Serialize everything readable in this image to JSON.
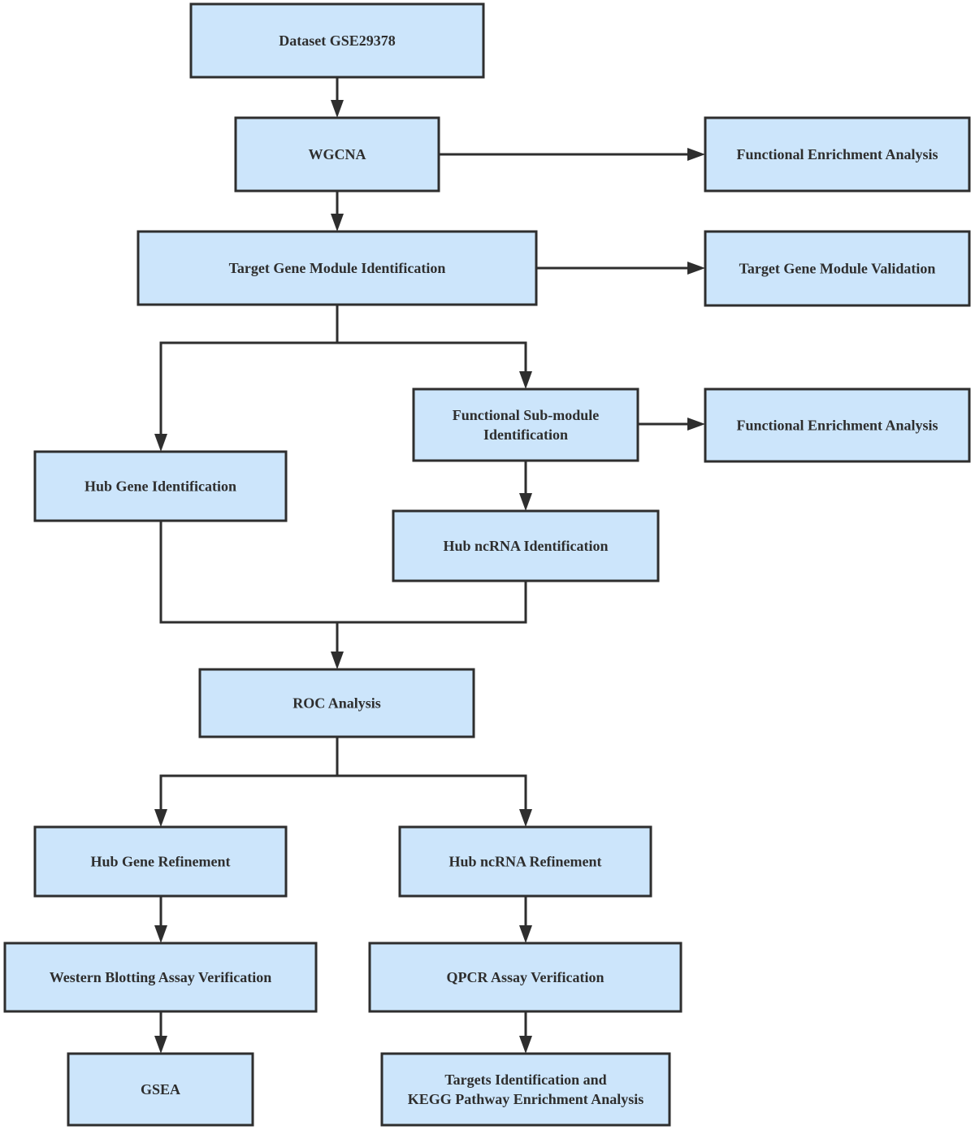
{
  "diagram": {
    "type": "flowchart",
    "colors": {
      "box_fill": "#cce5fb",
      "box_border": "#2e2e2e",
      "text": "#2e2e2e",
      "edge": "#2e2e2e"
    },
    "nodes": [
      {
        "id": "dataset",
        "lines": [
          "Dataset GSE29378"
        ]
      },
      {
        "id": "wgcna",
        "lines": [
          "WGCNA"
        ]
      },
      {
        "id": "fea1",
        "lines": [
          "Functional Enrichment Analysis"
        ]
      },
      {
        "id": "tgmi",
        "lines": [
          "Target Gene Module Identification"
        ]
      },
      {
        "id": "tgmv",
        "lines": [
          "Target Gene Module Validation"
        ]
      },
      {
        "id": "fsmi",
        "lines": [
          "Functional Sub-module",
          "Identification"
        ]
      },
      {
        "id": "fea2",
        "lines": [
          "Functional Enrichment Analysis"
        ]
      },
      {
        "id": "hubgene",
        "lines": [
          "Hub Gene Identification"
        ]
      },
      {
        "id": "hubncrna",
        "lines": [
          "Hub ncRNA Identification"
        ]
      },
      {
        "id": "roc",
        "lines": [
          "ROC Analysis"
        ]
      },
      {
        "id": "hgref",
        "lines": [
          "Hub Gene Refinement"
        ]
      },
      {
        "id": "hnref",
        "lines": [
          "Hub ncRNA Refinement"
        ]
      },
      {
        "id": "wb",
        "lines": [
          "Western Blotting Assay Verification"
        ]
      },
      {
        "id": "qpcr",
        "lines": [
          "QPCR Assay Verification"
        ]
      },
      {
        "id": "gsea",
        "lines": [
          "GSEA"
        ]
      },
      {
        "id": "kegg",
        "lines": [
          "Targets Identification and",
          "KEGG Pathway Enrichment Analysis"
        ]
      }
    ],
    "edges": [
      {
        "from": "dataset",
        "to": "wgcna"
      },
      {
        "from": "wgcna",
        "to": "fea1"
      },
      {
        "from": "wgcna",
        "to": "tgmi"
      },
      {
        "from": "tgmi",
        "to": "tgmv"
      },
      {
        "from": "tgmi",
        "to": "hubgene"
      },
      {
        "from": "tgmi",
        "to": "fsmi"
      },
      {
        "from": "fsmi",
        "to": "fea2"
      },
      {
        "from": "fsmi",
        "to": "hubncrna"
      },
      {
        "from": "hubgene",
        "to": "roc"
      },
      {
        "from": "hubncrna",
        "to": "roc"
      },
      {
        "from": "roc",
        "to": "hgref"
      },
      {
        "from": "roc",
        "to": "hnref"
      },
      {
        "from": "hgref",
        "to": "wb"
      },
      {
        "from": "hnref",
        "to": "qpcr"
      },
      {
        "from": "wb",
        "to": "gsea"
      },
      {
        "from": "qpcr",
        "to": "kegg"
      }
    ]
  }
}
